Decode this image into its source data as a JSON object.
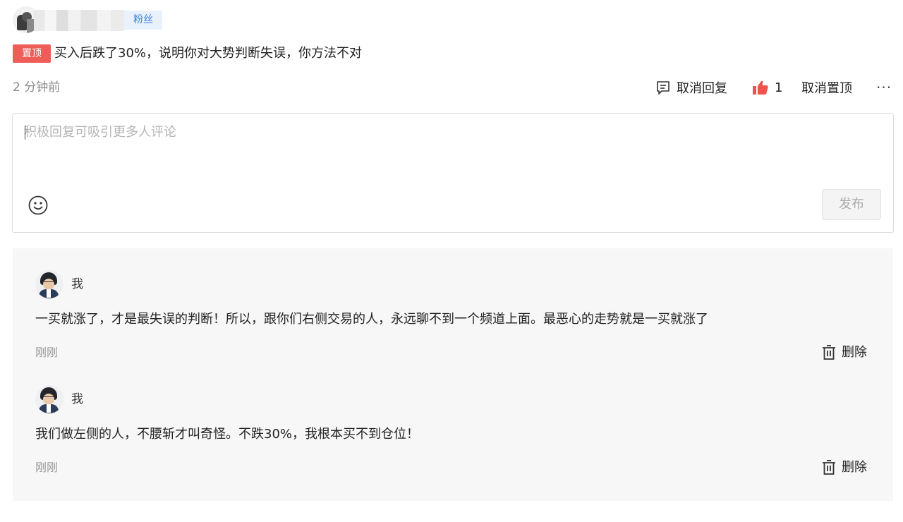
{
  "header": {
    "fan_badge": "粉丝",
    "pin_tag": "置顶",
    "comment_text": "买入后跌了30%，说明你对大势判断失误，你方法不对",
    "time": "2 分钟前"
  },
  "actions": {
    "reply_label": "取消回复",
    "like_count": "1",
    "unpin_label": "取消置顶",
    "more_label": "···"
  },
  "reply_box": {
    "placeholder": "积极回复可吸引更多人评论",
    "publish_label": "发布"
  },
  "replies": [
    {
      "name": "我",
      "text": "一买就涨了，才是最失误的判断！所以，跟你们右侧交易的人，永远聊不到一个频道上面。最恶心的走势就是一买就涨了",
      "time": "刚刚",
      "delete_label": "删除"
    },
    {
      "name": "我",
      "text": "我们做左侧的人，不腰斩才叫奇怪。不跌30%，我根本买不到仓位！",
      "time": "刚刚",
      "delete_label": "删除"
    }
  ],
  "colors": {
    "pin_red": "#ee5d57",
    "like_red": "#f0524d",
    "badge_blue": "#3a7ee0",
    "reply_bg": "#f7f7f7"
  },
  "icons": {
    "reply": "comment-icon",
    "like": "thumbs-up-icon",
    "emoji": "smiley-icon",
    "delete": "trash-icon"
  }
}
